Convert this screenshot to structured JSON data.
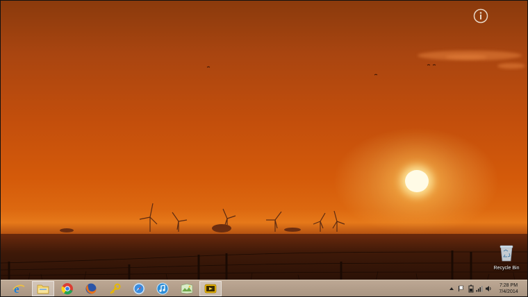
{
  "desktop": {
    "recycle_bin_label": "Recycle Bin",
    "info_icon": "info-icon"
  },
  "taskbar": {
    "apps": [
      {
        "name": "internet-explorer",
        "icon": "ie-icon"
      },
      {
        "name": "file-explorer",
        "icon": "folder-icon",
        "active": true
      },
      {
        "name": "chrome",
        "icon": "chrome-icon"
      },
      {
        "name": "firefox",
        "icon": "firefox-icon"
      },
      {
        "name": "app-yellow",
        "icon": "key-icon"
      },
      {
        "name": "safari",
        "icon": "safari-icon"
      },
      {
        "name": "itunes",
        "icon": "itunes-icon"
      },
      {
        "name": "windows-live",
        "icon": "photo-gallery-icon"
      },
      {
        "name": "media-player",
        "icon": "media-player-icon"
      }
    ],
    "tray": {
      "time": "7:28 PM",
      "date": "7/4/2014"
    }
  },
  "colors": {
    "sky_top": "#8a3a0c",
    "sky_mid": "#d45a0a",
    "sun": "#fffbe6",
    "taskbar": "#c4ad98"
  }
}
